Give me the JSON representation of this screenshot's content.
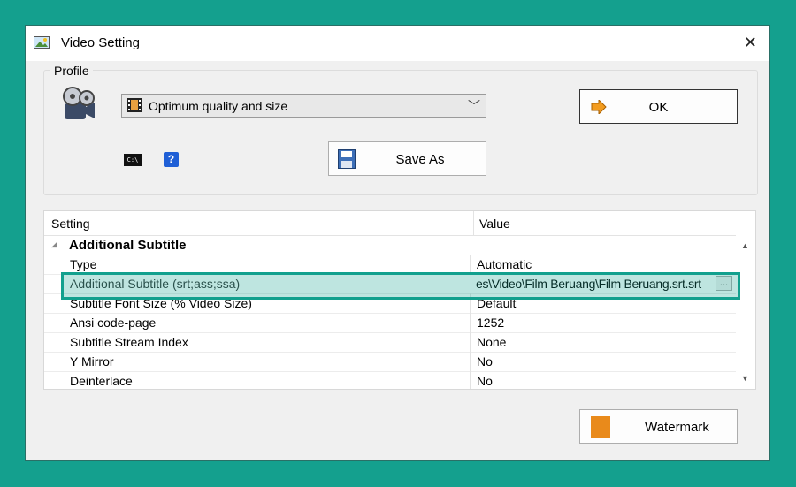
{
  "window": {
    "title": "Video Setting",
    "close_glyph": "✕",
    "icon": "image-icon"
  },
  "profile": {
    "group_label": "Profile",
    "selected_profile": "Optimum quality and size",
    "ok_label": "OK",
    "save_as_label": "Save As",
    "cmd_icon_text": "C:\\",
    "help_icon_text": "?"
  },
  "grid": {
    "headers": {
      "setting": "Setting",
      "value": "Value"
    },
    "category": "Additional Subtitle",
    "rows": [
      {
        "key": "Type",
        "value": "Automatic"
      },
      {
        "key": "Additional Subtitle (srt;ass;ssa)",
        "value": "es\\Video\\Film Beruang\\Film Beruang.srt.srt",
        "selected": true
      },
      {
        "key": "Subtitle Font Size (% Video Size)",
        "value": "Default"
      },
      {
        "key": "Ansi code-page",
        "value": "1252"
      },
      {
        "key": "Subtitle Stream Index",
        "value": "None"
      },
      {
        "key": "Y Mirror",
        "value": "No"
      },
      {
        "key": "Deinterlace",
        "value": "No"
      }
    ],
    "browse_label": "..."
  },
  "watermark_label": "Watermark",
  "colors": {
    "background": "#14a08e",
    "highlight": "#12a08e",
    "watermark_icon": "#e98a1b"
  }
}
